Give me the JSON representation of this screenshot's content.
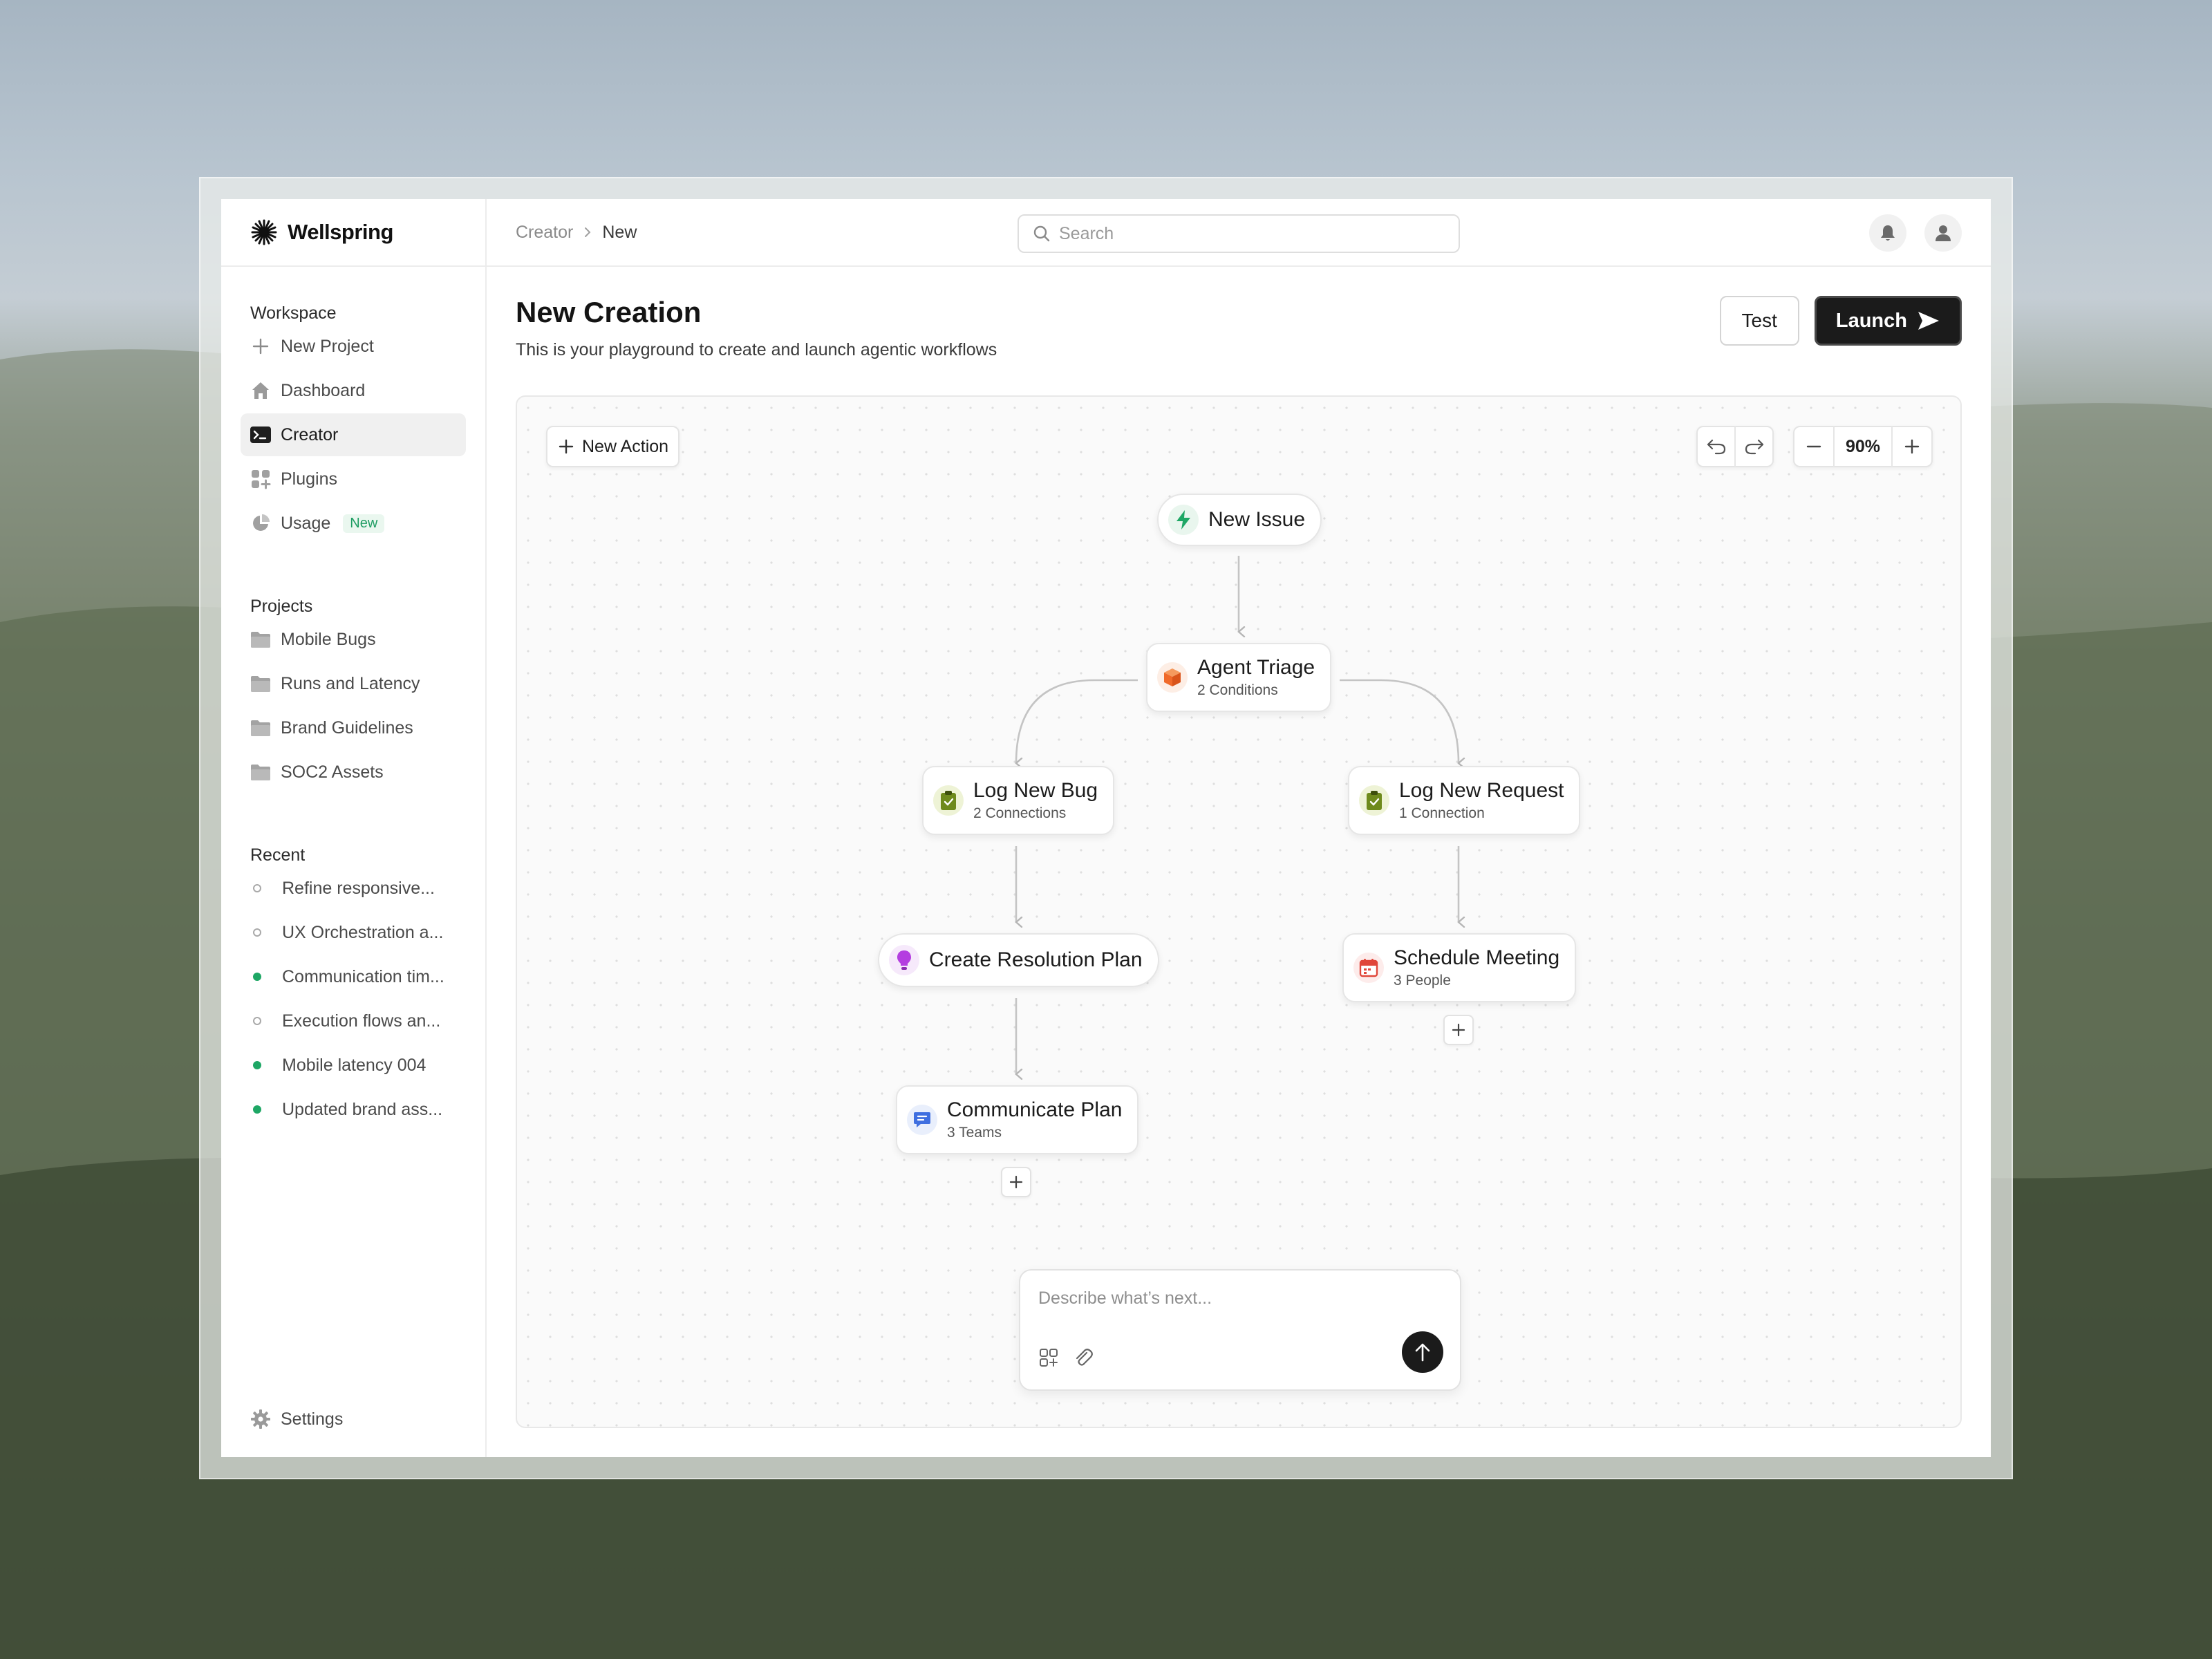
{
  "brand": {
    "name": "Wellspring"
  },
  "sidebar": {
    "workspace_heading": "Workspace",
    "workspace_items": [
      {
        "label": "New Project",
        "icon": "plus-icon"
      },
      {
        "label": "Dashboard",
        "icon": "home-icon"
      },
      {
        "label": "Creator",
        "icon": "terminal-icon",
        "active": true
      },
      {
        "label": "Plugins",
        "icon": "grid-plus-icon"
      },
      {
        "label": "Usage",
        "icon": "pie-chart-icon",
        "badge": "New"
      }
    ],
    "projects_heading": "Projects",
    "projects": [
      "Mobile Bugs",
      "Runs and Latency",
      "Brand Guidelines",
      "SOC2 Assets"
    ],
    "recent_heading": "Recent",
    "recent": [
      {
        "label": "Refine responsive...",
        "status": "open"
      },
      {
        "label": "UX Orchestration a...",
        "status": "open"
      },
      {
        "label": "Communication tim...",
        "status": "done"
      },
      {
        "label": "Execution flows an...",
        "status": "open"
      },
      {
        "label": "Mobile latency 004",
        "status": "done"
      },
      {
        "label": "Updated brand ass...",
        "status": "done"
      }
    ],
    "settings_label": "Settings"
  },
  "topbar": {
    "breadcrumb": [
      "Creator",
      "New"
    ],
    "search_placeholder": "Search"
  },
  "page": {
    "title": "New Creation",
    "subtitle": "This is your playground to create and launch agentic workflows",
    "test_label": "Test",
    "launch_label": "Launch"
  },
  "canvas": {
    "new_action_label": "New Action",
    "zoom": "90%",
    "nodes": {
      "new_issue": {
        "title": "New Issue",
        "icon": "lightning-icon",
        "color": "#1ea765"
      },
      "agent_triage": {
        "title": "Agent Triage",
        "sub": "2 Conditions",
        "icon": "cube-icon",
        "color": "#f06a2a"
      },
      "log_bug": {
        "title": "Log New Bug",
        "sub": "2 Connections",
        "icon": "clipboard-icon",
        "color": "#7a8f1e"
      },
      "log_request": {
        "title": "Log New Request",
        "sub": "1 Connection",
        "icon": "clipboard-icon",
        "color": "#7a8f1e"
      },
      "resolution": {
        "title": "Create Resolution Plan",
        "icon": "lightbulb-icon",
        "color": "#b43ee0"
      },
      "schedule": {
        "title": "Schedule Meeting",
        "sub": "3 People",
        "icon": "calendar-icon",
        "color": "#e0463a"
      },
      "communicate": {
        "title": "Communicate Plan",
        "sub": "3 Teams",
        "icon": "chat-icon",
        "color": "#3f6fe0"
      }
    },
    "composer_placeholder": "Describe what’s next..."
  }
}
